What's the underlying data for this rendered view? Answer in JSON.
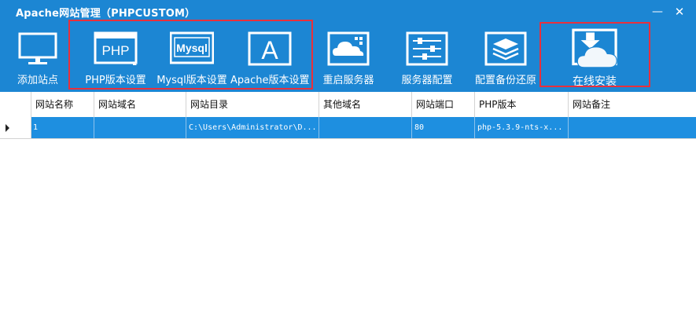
{
  "window": {
    "title": "Apache网站管理（PHPCUSTOM）",
    "minimize_icon": "minimize-icon",
    "close_icon": "close-icon",
    "min_glyph": "—",
    "close_glyph": "✕"
  },
  "toolbar": {
    "items": [
      {
        "id": "add-site",
        "label": "添加站点",
        "icon": "monitor-icon"
      },
      {
        "id": "php-version",
        "label": "PHP版本设置",
        "icon": "php-icon",
        "icon_text": "PHP"
      },
      {
        "id": "mysql-version",
        "label": "Mysql版本设置",
        "icon": "mysql-icon",
        "icon_text": "Mysql"
      },
      {
        "id": "apache-version",
        "label": "Apache版本设置",
        "icon": "apache-icon",
        "icon_text": "A"
      },
      {
        "id": "restart-server",
        "label": "重启服务器",
        "icon": "cloud-server-icon"
      },
      {
        "id": "server-config",
        "label": "服务器配置",
        "icon": "sliders-icon"
      },
      {
        "id": "backup-restore",
        "label": "配置备份还原",
        "icon": "layers-icon"
      },
      {
        "id": "online-install",
        "label": "在线安装",
        "icon": "cloud-download-icon"
      }
    ]
  },
  "grid": {
    "columns": [
      "网站名称",
      "网站域名",
      "网站目录",
      "其他域名",
      "网站端口",
      "PHP版本",
      "网站备注"
    ],
    "rows": [
      {
        "cells": [
          "1",
          "",
          "C:\\Users\\Administrator\\D...",
          "",
          "80",
          "php-5.3.9-nts-x...",
          ""
        ]
      }
    ]
  },
  "colors": {
    "titlebar": "#1c86d3",
    "selected_row": "#1e8fe0",
    "highlight": "#e8303c"
  }
}
